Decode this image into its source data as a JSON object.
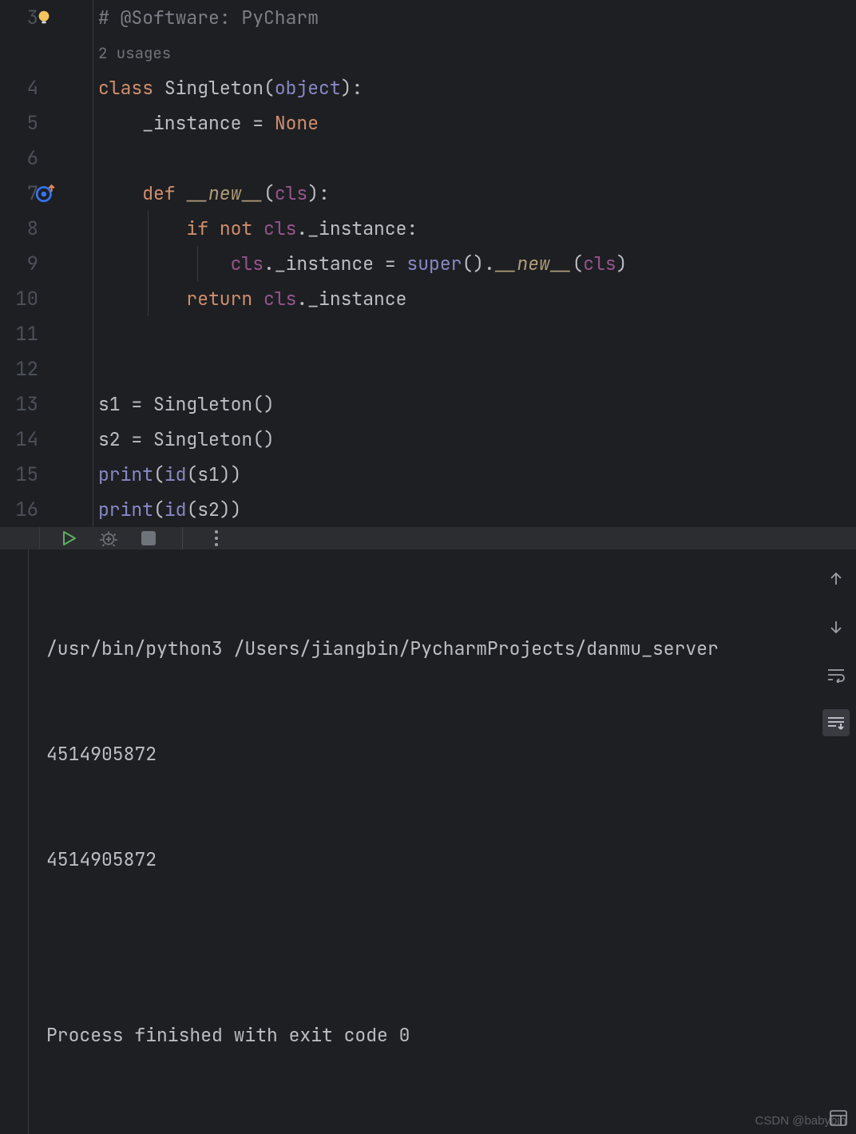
{
  "editor": {
    "first_line_number": 3,
    "lines": [
      {
        "n": 3,
        "type": "comment",
        "text": "# @Software: PyCharm",
        "bulb": true
      },
      {
        "n": null,
        "type": "usages",
        "text": "2 usages"
      },
      {
        "n": 4,
        "type": "classdef",
        "kw": "class ",
        "name": "Singleton",
        "open": "(",
        "base": "object",
        "close": "):"
      },
      {
        "n": 5,
        "type": "assign",
        "indent": "    ",
        "lhs": "_instance",
        "eq": " = ",
        "rhs": "None",
        "rhs_kind": "none"
      },
      {
        "n": 6,
        "type": "blank"
      },
      {
        "n": 7,
        "type": "def",
        "indent": "    ",
        "kw": "def ",
        "magic": "__new__",
        "open": "(",
        "param": "cls",
        "close": "):",
        "override": true
      },
      {
        "n": 8,
        "type": "if",
        "indent": "        ",
        "kw": "if ",
        "kw2": "not ",
        "self": "cls",
        "rest": "._instance:",
        "guide": [
          1
        ]
      },
      {
        "n": 9,
        "type": "stmt",
        "indent": "            ",
        "self": "cls",
        "mid": "._instance = ",
        "sup": "super",
        "mid2": "().",
        "magic": "__new__",
        "open": "(",
        "param": "cls",
        "close": ")",
        "guide": [
          1,
          2
        ]
      },
      {
        "n": 10,
        "type": "return",
        "indent": "        ",
        "kw": "return ",
        "self": "cls",
        "rest": "._instance",
        "guide": [
          1
        ]
      },
      {
        "n": 11,
        "type": "blank"
      },
      {
        "n": 12,
        "type": "blank"
      },
      {
        "n": 13,
        "type": "plain",
        "text": "s1 = Singleton()"
      },
      {
        "n": 14,
        "type": "plain",
        "text": "s2 = Singleton()"
      },
      {
        "n": 15,
        "type": "print",
        "fn": "print",
        "open": "(",
        "bi": "id",
        "args": "(s1))"
      },
      {
        "n": 16,
        "type": "print",
        "fn": "print",
        "open": "(",
        "bi": "id",
        "args": "(s2))"
      }
    ]
  },
  "toolbar": {
    "run": "run-icon",
    "debug": "debug-icon",
    "stop": "stop-icon",
    "more": "more-icon"
  },
  "console": {
    "cmd": "/usr/bin/python3 /Users/jiangbin/PycharmProjects/danmu_server",
    "out1": "4514905872",
    "out2": "4514905872",
    "blank": "",
    "exit": "Process finished with exit code 0"
  },
  "side": {
    "up": "up-arrow-icon",
    "down": "down-arrow-icon",
    "wrap": "soft-wrap-icon",
    "scroll": "scroll-to-end-icon"
  },
  "watermark": "CSDN @babybin",
  "colors": {
    "bg": "#1e1f22",
    "kw": "#cf8e6d",
    "builtin": "#8888c6",
    "self": "#94558d"
  }
}
